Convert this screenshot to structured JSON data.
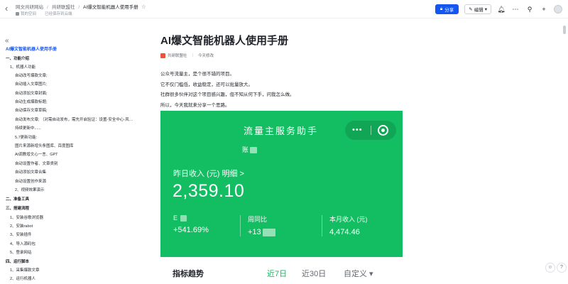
{
  "topbar": {
    "breadcrumbs": [
      "网文共研网站",
      "共研联盟社",
      "AI爆文智能机器人使用手册"
    ],
    "sub": [
      "我的空间",
      "已经保存到云端"
    ],
    "share_label": "分享",
    "edit_label": "编辑",
    "icons": [
      "back-icon",
      "star-icon",
      "bell-icon",
      "more-icon",
      "search-icon",
      "plus-icon",
      "avatar"
    ]
  },
  "toc": {
    "title": "AI爆文智能机器人使用手册",
    "items": [
      {
        "label": "一、功能介绍",
        "level": 1
      },
      {
        "label": "1、机器人功能",
        "level": 2
      },
      {
        "label": "自动改写爆款文章;",
        "level": 3
      },
      {
        "label": "自动插入文章图片;",
        "level": 3
      },
      {
        "label": "自动添加文章封面;",
        "level": 3
      },
      {
        "label": "自动生成爆款标题;",
        "level": 3
      },
      {
        "label": "自动保存文章草稿;",
        "level": 3
      },
      {
        "label": "自动发布文章; （对需自动发布，需先开启验证：设置-安全中心-风…",
        "level": 3
      },
      {
        "label": "持续更新中......",
        "level": 3
      },
      {
        "label": "5.7更新功能:",
        "level": 3
      },
      {
        "label": "图片来源新增头条图库、百度图库",
        "level": 3
      },
      {
        "label": "AI调教增文心一言、GPT",
        "level": 3
      },
      {
        "label": "自动设置作者、文章类别",
        "level": 3
      },
      {
        "label": "自动添加文章合集",
        "level": 3
      },
      {
        "label": "自动设置创作来源",
        "level": 3
      },
      {
        "label": "2、视频效果演示",
        "level": 2
      },
      {
        "label": "二、准备工具",
        "level": 1
      },
      {
        "label": "三、搭建流程",
        "level": 1
      },
      {
        "label": "1、安装谷歌浏览器",
        "level": 2
      },
      {
        "label": "2、安装rabot",
        "level": 2
      },
      {
        "label": "3、安装插件",
        "level": 2
      },
      {
        "label": "4、导入源码包",
        "level": 2
      },
      {
        "label": "5、登录网站",
        "level": 2
      },
      {
        "label": "四、运行脚本",
        "level": 1
      },
      {
        "label": "1、采集爆款文章",
        "level": 2
      },
      {
        "label": "2、运行机器人",
        "level": 2
      }
    ]
  },
  "doc": {
    "title": "AI爆文智能机器人使用手册",
    "author": "共研联盟社",
    "modified": "今天修改",
    "paragraphs": [
      "公众号流量主，是个很不错的项目。",
      "它不仅门槛低，收益稳定，还可以批量放大。",
      "社群很多伙伴对这个项目感兴趣，但不知从何下手，问我怎么做。",
      "所以，今天我就来分享一个思路。"
    ]
  },
  "screenshot": {
    "title": "流量主服务助手",
    "sub": "账",
    "yesterday_label": "昨日收入 (元)  明细 >",
    "yesterday_value": "2,359.10",
    "stats": [
      {
        "label": "E",
        "value": "+541.69%"
      },
      {
        "label": "周同比",
        "value": "+13"
      },
      {
        "label": "本月收入 (元)",
        "value": "4,474.46"
      }
    ],
    "panel_title": "指标趋势",
    "filters": [
      "近7日",
      "近30日",
      "自定义 ▾"
    ],
    "accent": "#13bd62"
  },
  "colors": {
    "brand": "#1456f0",
    "text": "#1f2329",
    "muted": "#646a73"
  }
}
